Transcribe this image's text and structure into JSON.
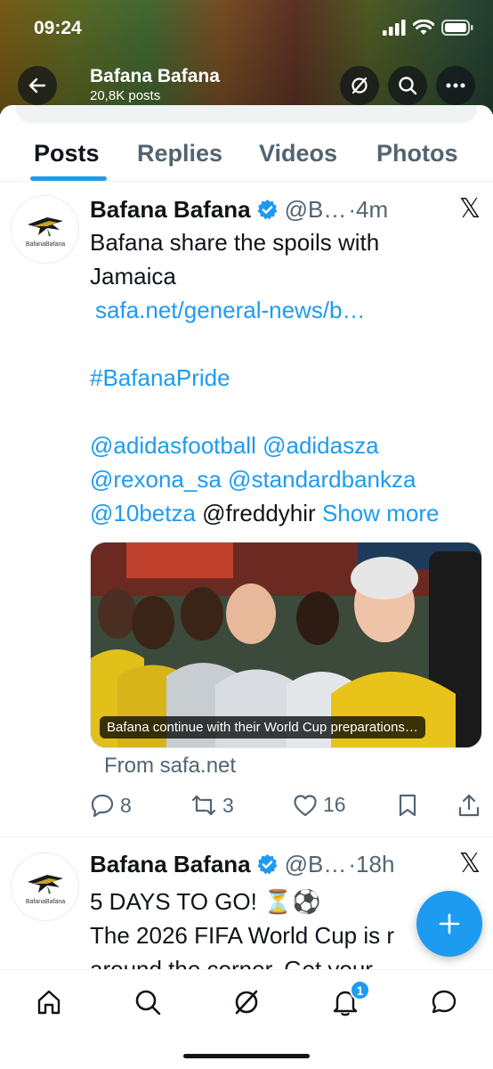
{
  "status_bar": {
    "time": "09:24"
  },
  "header": {
    "title": "Bafana Bafana",
    "subtitle": "20,8K posts"
  },
  "tabs": [
    {
      "label": "Posts",
      "active": true
    },
    {
      "label": "Replies",
      "active": false
    },
    {
      "label": "Videos",
      "active": false
    },
    {
      "label": "Photos",
      "active": false
    }
  ],
  "posts": [
    {
      "name": "Bafana Bafana",
      "handle": "@B…",
      "time": "·4m",
      "avatar_text": "BafanaBafana",
      "text_line1": "Bafana share the spoils with",
      "text_line2": "Jamaica",
      "link": "safa.net/general-news/b…",
      "hashtag": "#BafanaPride",
      "mention1": "@adidasfootball",
      "mention2": "@adidasza",
      "mention3": "@rexona_sa",
      "mention4": "@standardbankza",
      "mention5": "@10betza",
      "mention6": "@freddyhir",
      "show_more": "Show more",
      "card_caption": "Bafana continue with their World Cup preparations…",
      "card_source": "From safa.net",
      "replies": "8",
      "reposts": "3",
      "likes": "16"
    },
    {
      "name": "Bafana Bafana",
      "handle": "@B…",
      "time": "·18h",
      "avatar_text": "BafanaBafana",
      "text_line1": "5 DAYS TO GO! ⏳⚽",
      "text_line2": "The 2026 FIFA World Cup is r",
      "text_line3": "around the corner. Get your"
    }
  ],
  "bottom_nav": {
    "notifications_badge": "1"
  },
  "colors": {
    "accent": "#1d9bf0",
    "text": "#0f1419",
    "muted": "#536471"
  }
}
